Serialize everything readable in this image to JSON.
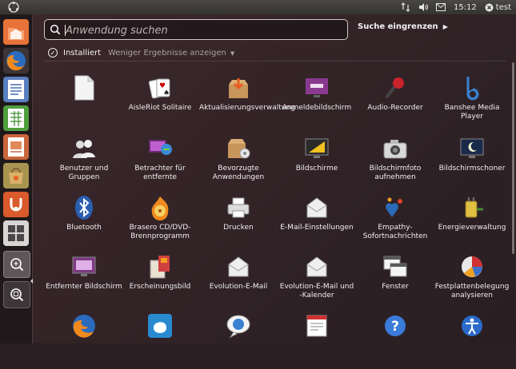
{
  "top_panel": {
    "user": "test",
    "clock": "15:12",
    "icons": [
      "network-icon",
      "volume-icon",
      "mail-icon",
      "clock",
      "power-icon"
    ]
  },
  "launcher": {
    "items": [
      "ubuntu-software-icon",
      "firefox-icon",
      "libreoffice-writer-icon",
      "libreoffice-calc-icon",
      "libreoffice-impress-icon",
      "software-center-icon",
      "ubuntu-one-icon",
      "workspace-switcher-icon",
      "lens-applications-icon",
      "lens-files-icon"
    ]
  },
  "dash": {
    "search_placeholder": "Anwendung suchen",
    "refine_label": "Suche eingrenzen",
    "filter": {
      "installed_label": "Installiert",
      "fewer_label": "Weniger Ergebnisse anzeigen"
    },
    "apps": [
      {
        "label": "",
        "icon": "libreoffice-icon"
      },
      {
        "label": "AisleRiot Solitaire",
        "icon": "cards-icon"
      },
      {
        "label": "Aktualisierungsverwaltung",
        "icon": "update-manager-icon"
      },
      {
        "label": "Anmeldebildschirm",
        "icon": "login-screen-icon"
      },
      {
        "label": "Audio-Recorder",
        "icon": "microphone-icon"
      },
      {
        "label": "Banshee Media Player",
        "icon": "banshee-icon"
      },
      {
        "label": "Benutzer und Gruppen",
        "icon": "users-icon"
      },
      {
        "label": "Betrachter für entfernte",
        "icon": "remote-viewer-icon"
      },
      {
        "label": "Bevorzugte Anwendungen",
        "icon": "preferred-apps-icon"
      },
      {
        "label": "Bildschirme",
        "icon": "displays-icon"
      },
      {
        "label": "Bildschirmfoto aufnehmen",
        "icon": "camera-icon"
      },
      {
        "label": "Bildschirmschoner",
        "icon": "screensaver-icon"
      },
      {
        "label": "Bluetooth",
        "icon": "bluetooth-icon"
      },
      {
        "label": "Brasero CD/DVD-Brennprogramm",
        "icon": "brasero-icon"
      },
      {
        "label": "Drucken",
        "icon": "printer-icon"
      },
      {
        "label": "E-Mail-Einstellungen",
        "icon": "email-settings-icon"
      },
      {
        "label": "Empathy-Sofortnachrichten",
        "icon": "empathy-icon"
      },
      {
        "label": "Energieverwaltung",
        "icon": "power-manager-icon"
      },
      {
        "label": "Entfernter Bildschirm",
        "icon": "remote-desktop-icon"
      },
      {
        "label": "Erscheinungsbild",
        "icon": "appearance-icon"
      },
      {
        "label": "Evolution-E-Mail",
        "icon": "evolution-mail-icon"
      },
      {
        "label": "Evolution-E-Mail und -Kalender",
        "icon": "evolution-calendar-icon"
      },
      {
        "label": "Fenster",
        "icon": "windows-icon"
      },
      {
        "label": "Festplattenbelegung analysieren",
        "icon": "disk-usage-icon"
      },
      {
        "label": "",
        "icon": "firefox-icon"
      },
      {
        "label": "",
        "icon": "mind-map-icon"
      },
      {
        "label": "",
        "icon": "chat-globe-icon"
      },
      {
        "label": "",
        "icon": "presentation-icon"
      },
      {
        "label": "",
        "icon": "help-icon"
      },
      {
        "label": "",
        "icon": "accessibility-icon"
      }
    ]
  }
}
